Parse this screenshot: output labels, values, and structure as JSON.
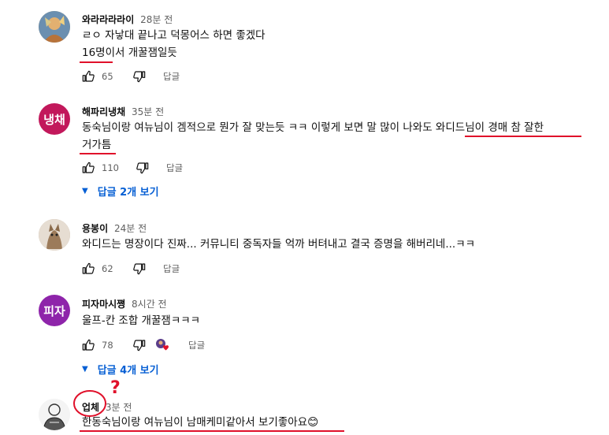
{
  "comments": [
    {
      "author": "와라라라라이",
      "time": "28분 전",
      "lines": [
        "ㄹㅇ 자낳대 끝나고 덕몽어스 하면 좋겠다",
        "16명이서 개꿀잼일듯"
      ],
      "likes": "65",
      "reply": "답글",
      "avatar": "photo-avatar"
    },
    {
      "author": "해파리냉채",
      "time": "35분 전",
      "lines": [
        "동숙님이랑 여뉴님이 겜적으로 뭔가 잘 맞는듯 ㅋㅋ 이렇게 보면 말 많이 나와도 와디드님이 경매 참 잘한",
        "거가틈"
      ],
      "likes": "110",
      "reply": "답글",
      "avatar_text": "냉채",
      "avatar_color": "#c2185b",
      "replies_toggle": "답글 2개 보기"
    },
    {
      "author": "용봉이",
      "time": "24분 전",
      "lines": [
        "와디드는 명장이다 진짜... 커뮤니티 중독자들 억까 버텨내고 결국 증명을 해버리네...ㅋㅋ"
      ],
      "likes": "62",
      "reply": "답글",
      "avatar": "cat-photo-avatar"
    },
    {
      "author": "피자마시쪙",
      "time": "8시간 전",
      "lines": [
        "울프-칸 조합 개꿀잼ㅋㅋㅋ"
      ],
      "likes": "78",
      "reply": "답글",
      "avatar_text": "피자",
      "avatar_color": "#8e24aa",
      "replies_toggle": "답글 4개 보기"
    },
    {
      "author": "업체",
      "time": "3분 전",
      "lines": [
        "한동숙님이랑 여뉴님이 남매케미같아서 보기좋아요😊"
      ],
      "avatar": "sketch-avatar"
    }
  ],
  "annotation": {
    "question_mark": "?",
    "color": "#e0102a"
  },
  "icons": {
    "like": "thumbs-up-icon",
    "dislike": "thumbs-down-icon",
    "expand": "triangle-down-icon",
    "creator_heart": "creator-heart-icon"
  }
}
